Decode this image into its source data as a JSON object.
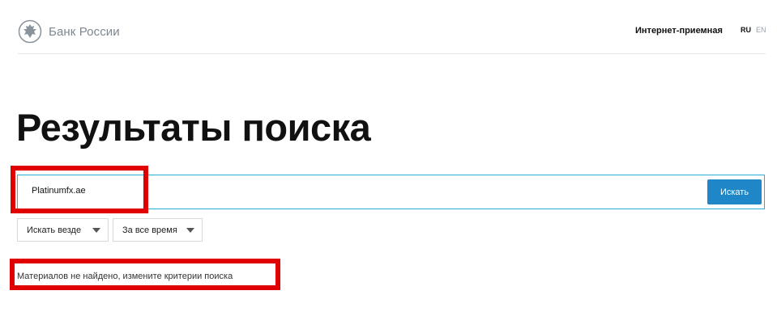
{
  "header": {
    "logo_text": "Банк России",
    "nav_link": "Интернет-приемная",
    "lang_ru": "RU",
    "lang_en": "EN"
  },
  "page_title": "Результаты поиска",
  "search": {
    "value": "Platinumfx.ae",
    "button_label": "Искать"
  },
  "filters": [
    {
      "label": "Искать везде"
    },
    {
      "label": "За все время"
    }
  ],
  "results": {
    "message": "Материалов не найдено, измените критерии поиска"
  },
  "colors": {
    "accent": "#1f86c7",
    "search_border": "#27b0d6",
    "annotation_red": "#e00000",
    "logo_gray": "#7d8691"
  },
  "icons": [
    "bank-emblem-icon",
    "chevron-down-icon"
  ]
}
